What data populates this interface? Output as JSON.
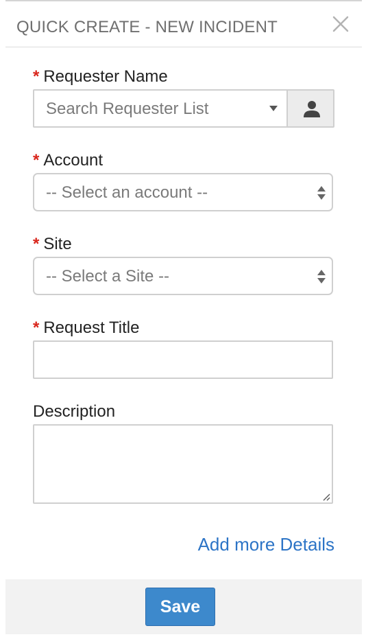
{
  "dialog": {
    "title": "QUICK CREATE - NEW INCIDENT"
  },
  "required_marker": "*",
  "fields": {
    "requester": {
      "label": "Requester Name",
      "placeholder": "Search Requester List",
      "required": true
    },
    "account": {
      "label": "Account",
      "selected": "-- Select an account --",
      "required": true
    },
    "site": {
      "label": "Site",
      "selected": "-- Select a Site --",
      "required": true
    },
    "request_title": {
      "label": "Request Title",
      "value": "",
      "required": true
    },
    "description": {
      "label": "Description",
      "value": "",
      "required": false
    }
  },
  "links": {
    "add_details": "Add more Details"
  },
  "footer": {
    "save_label": "Save"
  },
  "icons": {
    "close": "close-icon",
    "dropdown": "chevron-down-icon",
    "person": "person-icon",
    "select_arrows": "up-down-arrows-icon",
    "resize": "resize-handle-icon"
  },
  "colors": {
    "required_star": "#d9261c",
    "link": "#2c74c6",
    "primary_button": "#3d89cc",
    "footer_bg": "#f2f2f2",
    "border": "#cfcfcf"
  }
}
